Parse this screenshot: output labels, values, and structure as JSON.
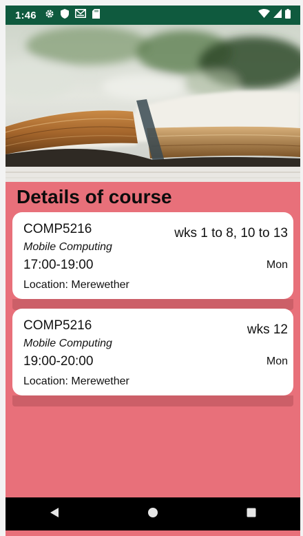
{
  "status_bar": {
    "time": "1:46",
    "background": "#0f5a3e",
    "left_icons": [
      "gear-icon",
      "shield-icon",
      "mail-icon",
      "sd-card-icon"
    ],
    "right_icons": [
      "wifi-icon",
      "signal-icon",
      "battery-icon"
    ]
  },
  "header_image": {
    "subject": "open-book-photo"
  },
  "page": {
    "title": "Details of course",
    "background": "#e8707a"
  },
  "courses": [
    {
      "code": "COMP5216",
      "name": "Mobile Computing",
      "time": "17:00-19:00",
      "weeks": "wks 1 to 8, 10 to 13",
      "day": "Mon",
      "location": "Location: Merewether"
    },
    {
      "code": "COMP5216",
      "name": "Mobile Computing",
      "time": "19:00-20:00",
      "weeks": "wks 12",
      "day": "Mon",
      "location": "Location: Merewether"
    }
  ],
  "nav_bar": {
    "buttons": [
      "back-icon",
      "home-icon",
      "recents-icon"
    ]
  }
}
